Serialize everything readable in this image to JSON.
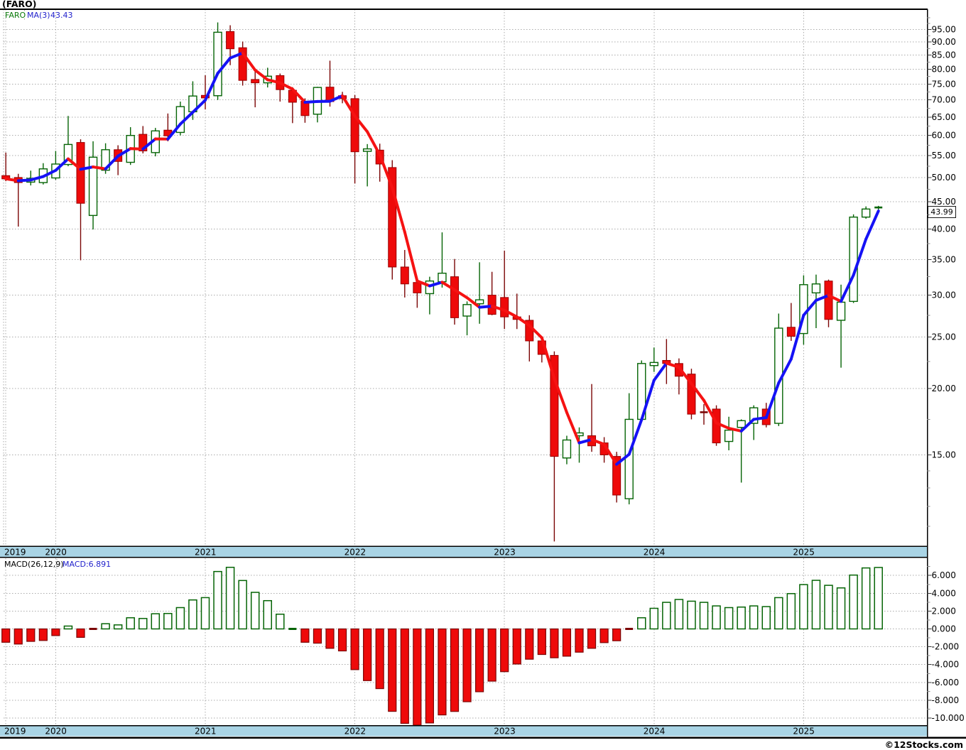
{
  "title": "(FARO)",
  "legend": {
    "symbol": "FARO",
    "ma_label": "MA(3)",
    "ma_value": "43.43"
  },
  "macd": {
    "label": "MACD(26,12,9)",
    "value": "MACD:6.891"
  },
  "last_price": "43.99",
  "watermark": "©12Stocks.com",
  "colors": {
    "candle_up_stroke": "#056405",
    "candle_down_fill": "#ee0a0a",
    "candle_down_stroke": "#990000",
    "wick_up": "#056405",
    "wick_down": "#7b0505",
    "ma_up": "#1512f5",
    "ma_down": "#f51212",
    "grid": "#ababab",
    "strip_fill": "#a9d4e5",
    "tag_bg": "#b2f0b2",
    "frame": "#000000"
  },
  "chart_data": [
    {
      "type": "candlestick",
      "title": "FARO monthly price",
      "scale": "log",
      "legend_position": "top-left",
      "grid": true,
      "months": [
        "2019-09",
        "2019-10",
        "2019-11",
        "2019-12",
        "2020-01",
        "2020-02",
        "2020-03",
        "2020-04",
        "2020-05",
        "2020-06",
        "2020-07",
        "2020-08",
        "2020-09",
        "2020-10",
        "2020-11",
        "2020-12",
        "2021-01",
        "2021-02",
        "2021-03",
        "2021-04",
        "2021-05",
        "2021-06",
        "2021-07",
        "2021-08",
        "2021-09",
        "2021-10",
        "2021-11",
        "2021-12",
        "2022-01",
        "2022-02",
        "2022-03",
        "2022-04",
        "2022-05",
        "2022-06",
        "2022-07",
        "2022-08",
        "2022-09",
        "2022-10",
        "2022-11",
        "2022-12",
        "2023-01",
        "2023-02",
        "2023-03",
        "2023-04",
        "2023-05",
        "2023-06",
        "2023-07",
        "2023-08",
        "2023-09",
        "2023-10",
        "2023-11",
        "2023-12",
        "2024-01",
        "2024-02",
        "2024-03",
        "2024-04",
        "2024-05",
        "2024-06",
        "2024-07",
        "2024-08",
        "2024-09",
        "2024-10",
        "2024-11",
        "2024-12",
        "2025-01",
        "2025-02",
        "2025-03",
        "2025-04",
        "2025-05",
        "2025-06",
        "2025-07"
      ],
      "ohlc": [
        [
          50.4,
          55.7,
          49.2,
          49.7
        ],
        [
          50.0,
          50.8,
          40.4,
          48.9
        ],
        [
          49.0,
          51.5,
          48.3,
          49.8
        ],
        [
          48.9,
          53.2,
          48.5,
          51.9
        ],
        [
          49.9,
          56.1,
          49.5,
          53.0
        ],
        [
          52.9,
          65.3,
          52.5,
          57.7
        ],
        [
          58.2,
          59.0,
          34.9,
          44.7
        ],
        [
          42.4,
          58.5,
          39.9,
          54.6
        ],
        [
          51.6,
          58.0,
          50.8,
          56.4
        ],
        [
          56.4,
          57.5,
          50.5,
          53.6
        ],
        [
          53.4,
          62.2,
          52.8,
          60.0
        ],
        [
          60.3,
          62.5,
          55.5,
          56.1
        ],
        [
          55.7,
          62.0,
          54.8,
          61.2
        ],
        [
          61.4,
          66.0,
          58.5,
          59.9
        ],
        [
          60.8,
          69.5,
          60.0,
          68.0
        ],
        [
          66.5,
          75.9,
          64.2,
          71.2
        ],
        [
          71.4,
          77.9,
          67.2,
          70.6
        ],
        [
          71.3,
          98.0,
          70.0,
          93.9
        ],
        [
          94.2,
          96.8,
          81.4,
          87.4
        ],
        [
          87.8,
          90.2,
          74.5,
          76.2
        ],
        [
          76.5,
          80.0,
          67.8,
          75.4
        ],
        [
          75.4,
          80.5,
          73.9,
          77.6
        ],
        [
          77.8,
          78.5,
          69.5,
          73.2
        ],
        [
          73.0,
          74.0,
          63.3,
          69.3
        ],
        [
          69.6,
          70.5,
          63.4,
          65.4
        ],
        [
          65.8,
          74.1,
          63.5,
          73.9
        ],
        [
          74.0,
          83.0,
          68.0,
          69.5
        ],
        [
          71.3,
          72.5,
          69.0,
          70.4
        ],
        [
          70.4,
          71.5,
          48.7,
          55.9
        ],
        [
          56.0,
          57.8,
          48.1,
          56.6
        ],
        [
          56.3,
          57.9,
          49.1,
          53.0
        ],
        [
          52.2,
          53.9,
          32.1,
          33.9
        ],
        [
          33.9,
          36.5,
          29.7,
          31.5
        ],
        [
          31.7,
          32.3,
          28.4,
          30.3
        ],
        [
          30.2,
          32.5,
          27.6,
          31.9
        ],
        [
          31.8,
          39.4,
          31.0,
          33.0
        ],
        [
          32.5,
          35.1,
          26.4,
          27.2
        ],
        [
          27.4,
          29.2,
          25.2,
          28.8
        ],
        [
          28.9,
          34.6,
          26.5,
          29.4
        ],
        [
          30.0,
          33.2,
          27.5,
          27.6
        ],
        [
          29.7,
          36.4,
          25.9,
          27.3
        ],
        [
          27.3,
          30.2,
          25.9,
          27.0
        ],
        [
          26.9,
          27.5,
          22.5,
          24.6
        ],
        [
          24.6,
          25.0,
          22.4,
          23.2
        ],
        [
          23.1,
          23.5,
          10.3,
          14.9
        ],
        [
          14.8,
          16.3,
          14.4,
          16.0
        ],
        [
          16.3,
          16.9,
          14.5,
          16.5
        ],
        [
          16.3,
          20.4,
          15.2,
          15.6
        ],
        [
          15.8,
          16.2,
          14.5,
          15.0
        ],
        [
          14.9,
          15.2,
          12.2,
          12.6
        ],
        [
          12.4,
          19.6,
          12.1,
          17.5
        ],
        [
          17.5,
          22.6,
          17.3,
          22.3
        ],
        [
          22.1,
          23.9,
          21.5,
          22.4
        ],
        [
          22.6,
          24.8,
          20.4,
          22.3
        ],
        [
          22.3,
          22.8,
          19.5,
          21.1
        ],
        [
          21.3,
          21.8,
          17.5,
          17.9
        ],
        [
          18.1,
          18.7,
          17.1,
          18.0
        ],
        [
          18.3,
          18.6,
          15.6,
          15.8
        ],
        [
          15.9,
          17.7,
          15.3,
          16.7
        ],
        [
          16.9,
          17.5,
          13.3,
          17.4
        ],
        [
          17.2,
          18.6,
          16.0,
          18.4
        ],
        [
          18.3,
          18.8,
          16.9,
          17.1
        ],
        [
          17.2,
          27.7,
          17.0,
          26.0
        ],
        [
          26.1,
          29.0,
          24.6,
          25.1
        ],
        [
          25.4,
          32.7,
          24.2,
          31.4
        ],
        [
          30.3,
          32.8,
          26.0,
          31.5
        ],
        [
          31.9,
          32.1,
          26.1,
          27.0
        ],
        [
          26.9,
          31.4,
          21.9,
          29.1
        ],
        [
          29.2,
          42.6,
          29.0,
          42.1
        ],
        [
          42.1,
          44.1,
          41.8,
          43.6
        ],
        [
          43.8,
          44.2,
          43.5,
          43.99
        ]
      ],
      "overlay": {
        "name": "MA(3)",
        "rule": "3-month moving average of close, blue when rising, red when falling",
        "last_value": 43.43
      },
      "last_close": 43.99,
      "price_axis": {
        "majors": [
          {
            "v": 95,
            "label": "95.00"
          },
          {
            "v": 90,
            "label": "90.00"
          },
          {
            "v": 85,
            "label": "85.00"
          },
          {
            "v": 80,
            "label": "80.00"
          },
          {
            "v": 75,
            "label": "75.00"
          },
          {
            "v": 70,
            "label": "70.00"
          },
          {
            "v": 65,
            "label": "65.00"
          },
          {
            "v": 60,
            "label": "60.00"
          },
          {
            "v": 55,
            "label": "55.00"
          },
          {
            "v": 50,
            "label": "50.00"
          },
          {
            "v": 45,
            "label": "45.00"
          },
          {
            "v": 40,
            "label": "40.00"
          },
          {
            "v": 35,
            "label": "35.00"
          },
          {
            "v": 30,
            "label": "30.00"
          },
          {
            "v": 25,
            "label": "25.00"
          },
          {
            "v": 20,
            "label": "20.00"
          },
          {
            "v": 15,
            "label": "15.00"
          }
        ],
        "minors": [
          100,
          97.5,
          92.5,
          87.5,
          82.5,
          77.5,
          72.5,
          67.5,
          62.5,
          57.5,
          52.5,
          47.5,
          42.5,
          37.5,
          32.5,
          27.5,
          22.5,
          17.5,
          14,
          13,
          12,
          11
        ]
      },
      "years": [
        {
          "label": "2019",
          "i": 0
        },
        {
          "label": "2020",
          "i": 4
        },
        {
          "label": "2021",
          "i": 16
        },
        {
          "label": "2022",
          "i": 28
        },
        {
          "label": "2023",
          "i": 40
        },
        {
          "label": "2024",
          "i": 52
        },
        {
          "label": "2025",
          "i": 64
        }
      ]
    },
    {
      "type": "bar",
      "name": "MACD(26,12,9) histogram",
      "values": [
        -1.5,
        -1.7,
        -1.4,
        -1.3,
        -0.75,
        0.32,
        -0.95,
        -0.1,
        0.58,
        0.45,
        1.25,
        1.17,
        1.7,
        1.73,
        2.39,
        3.25,
        3.51,
        6.44,
        6.91,
        5.43,
        4.1,
        3.17,
        1.65,
        0.1,
        -1.5,
        -1.6,
        -2.18,
        -2.47,
        -4.57,
        -5.8,
        -6.7,
        -9.25,
        -10.6,
        -11.1,
        -10.55,
        -9.65,
        -9.26,
        -8.17,
        -7.05,
        -5.86,
        -4.8,
        -3.94,
        -3.4,
        -2.87,
        -3.24,
        -3.06,
        -2.61,
        -2.18,
        -1.54,
        -1.33,
        -0.15,
        1.25,
        2.31,
        2.98,
        3.3,
        3.11,
        2.98,
        2.58,
        2.39,
        2.45,
        2.58,
        2.5,
        3.51,
        3.96,
        4.97,
        5.45,
        4.89,
        4.6,
        6.04,
        6.84,
        6.891
      ],
      "last_value": 6.891,
      "axis": {
        "majors": [
          {
            "v": 6,
            "label": "6.000"
          },
          {
            "v": 4,
            "label": "4.000"
          },
          {
            "v": 2,
            "label": "2.000"
          },
          {
            "v": 0,
            "label": "0.000"
          },
          {
            "v": -2,
            "label": "-2.000"
          },
          {
            "v": -4,
            "label": "-4.000"
          },
          {
            "v": -6,
            "label": "-6.000"
          },
          {
            "v": -8,
            "label": "-8.000"
          },
          {
            "v": -10,
            "label": "-10.000"
          }
        ],
        "minors": [
          7,
          5,
          3,
          1,
          -1,
          -3,
          -5,
          -7,
          -9
        ]
      }
    }
  ]
}
